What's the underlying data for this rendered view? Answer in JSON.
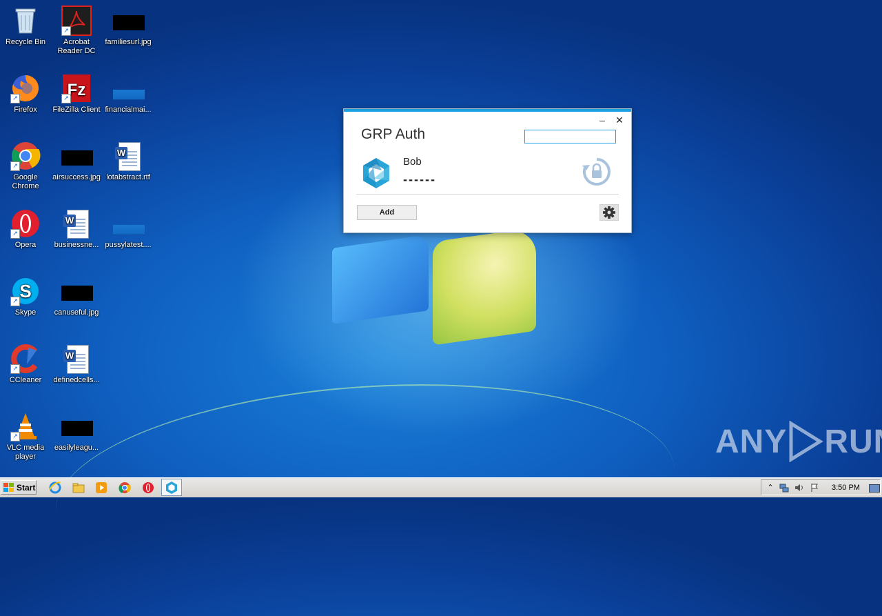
{
  "desktop": {
    "icons": [
      {
        "label": "Recycle Bin"
      },
      {
        "label": "Acrobat Reader DC"
      },
      {
        "label": "familiesurl.jpg"
      },
      {
        "label": "Firefox"
      },
      {
        "label": "FileZilla Client"
      },
      {
        "label": "financialmai..."
      },
      {
        "label": "Google Chrome"
      },
      {
        "label": "airsuccess.jpg"
      },
      {
        "label": "lotabstract.rtf"
      },
      {
        "label": "Opera"
      },
      {
        "label": "businessne..."
      },
      {
        "label": "pussylatest...."
      },
      {
        "label": "Skype"
      },
      {
        "label": "canuseful.jpg"
      },
      {
        "label": "CCleaner"
      },
      {
        "label": "definedcells..."
      },
      {
        "label": "VLC media player"
      },
      {
        "label": "easilyleagu..."
      }
    ]
  },
  "auth_window": {
    "title": "GRP Auth",
    "search_value": "",
    "account": {
      "name": "Bob",
      "code": "------"
    },
    "add_label": "Add",
    "minimize_glyph": "–",
    "close_glyph": "✕"
  },
  "watermark": {
    "left": "ANY",
    "right": "RUN"
  },
  "taskbar": {
    "start_label": "Start",
    "clock": "3:50 PM"
  },
  "colors": {
    "accent": "#1ba1e2",
    "desktop_blue": "#0f5fc0"
  }
}
